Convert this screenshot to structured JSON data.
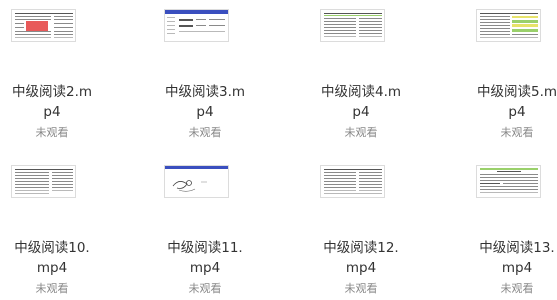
{
  "files": [
    {
      "name_line1": "中级阅读2.m",
      "name_line2": "p4",
      "status": "未观看"
    },
    {
      "name_line1": "中级阅读3.m",
      "name_line2": "p4",
      "status": "未观看"
    },
    {
      "name_line1": "中级阅读4.m",
      "name_line2": "p4",
      "status": "未观看"
    },
    {
      "name_line1": "中级阅读5.m",
      "name_line2": "p4",
      "status": "未观看"
    },
    {
      "name_line1": "中级阅读10.",
      "name_line2": "mp4",
      "status": "未观看"
    },
    {
      "name_line1": "中级阅读11.",
      "name_line2": "mp4",
      "status": "未观看"
    },
    {
      "name_line1": "中级阅读12.",
      "name_line2": "mp4",
      "status": "未观看"
    },
    {
      "name_line1": "中级阅读13.",
      "name_line2": "mp4",
      "status": "未观看"
    }
  ],
  "colors": {
    "text": "#333333",
    "status": "#888888",
    "highlight_red": "#e85a5a",
    "highlight_green": "#9ad06b",
    "highlight_yellow": "#e7e36a",
    "slide_bar": "#3a4fbf"
  },
  "icons": {
    "video_thumbnail": "video-thumbnail-icon"
  }
}
